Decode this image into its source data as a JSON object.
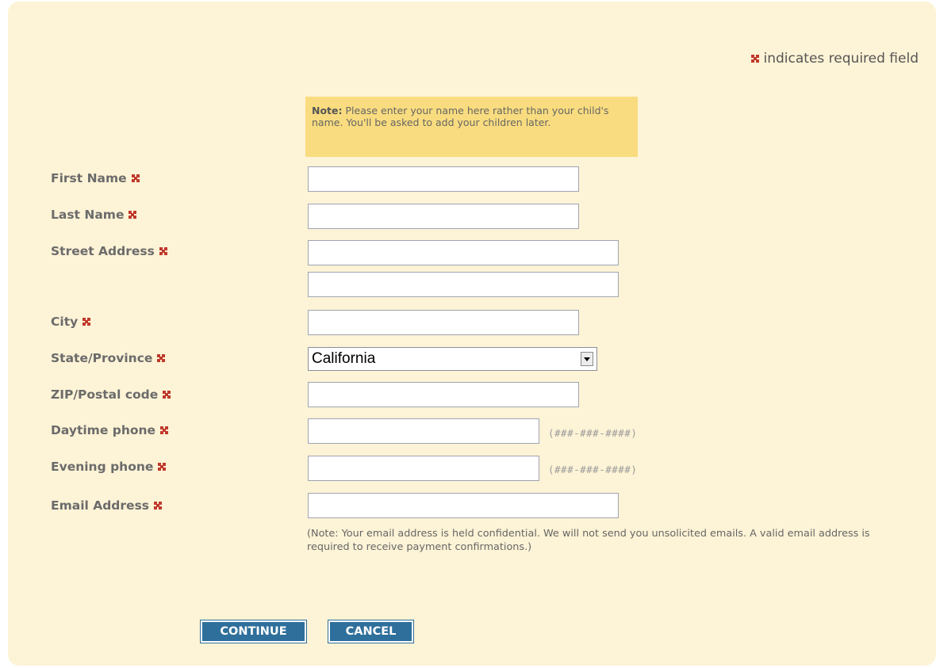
{
  "legend": {
    "text": "indicates required field"
  },
  "note": {
    "label": "Note:",
    "text": " Please enter your name here rather than your child's name. You'll be asked to add your children later."
  },
  "fields": {
    "first_name": {
      "label": "First Name",
      "value": ""
    },
    "last_name": {
      "label": "Last Name",
      "value": ""
    },
    "street_address": {
      "label": "Street Address",
      "value_line1": "",
      "value_line2": ""
    },
    "city": {
      "label": "City",
      "value": ""
    },
    "state": {
      "label": "State/Province",
      "value": "California"
    },
    "zip": {
      "label": "ZIP/Postal code",
      "value": ""
    },
    "day_phone": {
      "label": "Daytime phone",
      "value": "",
      "hint": "(###-###-####)"
    },
    "eve_phone": {
      "label": "Evening phone",
      "value": "",
      "hint": "(###-###-####)"
    },
    "email": {
      "label": "Email Address",
      "value": "",
      "note": "(Note: Your email address is held confidential. We will not send you unsolicited emails. A valid email address is required to receive payment confirmations.)"
    }
  },
  "buttons": {
    "continue": "CONTINUE",
    "cancel": "CANCEL"
  },
  "colors": {
    "required_star": "#c0392b",
    "panel_bg": "#fdf3d6",
    "note_bg": "#f9dc7f",
    "button_bg": "#2e6f9b"
  }
}
